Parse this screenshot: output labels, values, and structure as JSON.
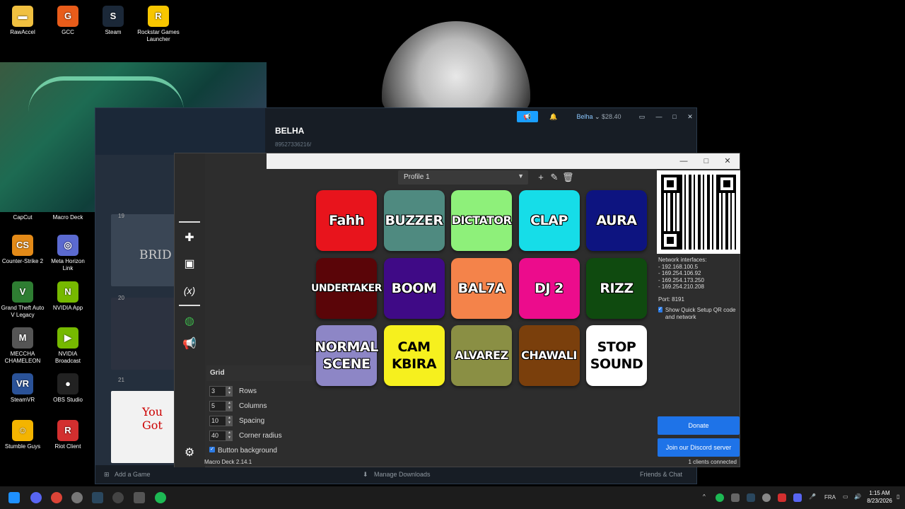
{
  "desktop_icons": [
    {
      "label": "RawAccel",
      "color": "#f0c040",
      "glyph": "▬"
    },
    {
      "label": "GCC",
      "color": "#e85c1a",
      "glyph": "G"
    },
    {
      "label": "Steam",
      "color": "#1b2838",
      "glyph": "S"
    },
    {
      "label": "Rockstar Games Launcher",
      "color": "#f7c600",
      "glyph": "R"
    },
    {
      "label": "CapCut",
      "color": "#222",
      "glyph": "✂"
    },
    {
      "label": "Macro Deck",
      "color": "#333",
      "glyph": "▦"
    },
    {
      "label": "Counter-Strike 2",
      "color": "#e38a18",
      "glyph": "CS"
    },
    {
      "label": "Meta Horizon Link",
      "color": "#5b6ad0",
      "glyph": "◎"
    },
    {
      "label": "Grand Theft Auto V Legacy",
      "color": "#2e7d32",
      "glyph": "V"
    },
    {
      "label": "NVIDIA App",
      "color": "#76b900",
      "glyph": "N"
    },
    {
      "label": "MECCHA CHAMELEON",
      "color": "#555",
      "glyph": "M"
    },
    {
      "label": "NVIDIA Broadcast",
      "color": "#76b900",
      "glyph": "▶"
    },
    {
      "label": "SteamVR",
      "color": "#2a5298",
      "glyph": "VR"
    },
    {
      "label": "OBS Studio",
      "color": "#222",
      "glyph": "●"
    },
    {
      "label": "Stumble Guys",
      "color": "#f4b400",
      "glyph": "☺"
    },
    {
      "label": "Riot Client",
      "color": "#d32f2f",
      "glyph": "R"
    }
  ],
  "steam": {
    "title": "BELHA",
    "subtitle": "89527336216/",
    "user": "Belha",
    "balance": "$28.40",
    "games": [
      "19",
      "20",
      "21"
    ],
    "tile_text": [
      "BRID",
      "You Got"
    ],
    "add_game": "Add a Game",
    "manage_downloads": "Manage Downloads",
    "friends_chat": "Friends & Chat"
  },
  "macro_deck": {
    "profile": "Profile 1",
    "version": "Macro Deck 2.14.1",
    "buttons": [
      {
        "label": "Fahh",
        "bg": "#e8141c",
        "color": "#ffffff"
      },
      {
        "label": "BUZZER",
        "bg": "#4f8a80",
        "color": "#ffffff"
      },
      {
        "label": "DICTATOR",
        "bg": "#8ef07a",
        "color": "#ffffff"
      },
      {
        "label": "CLAP",
        "bg": "#16dde8",
        "color": "#ffffff"
      },
      {
        "label": "AURA",
        "bg": "#0d1480",
        "color": "#ffffff"
      },
      {
        "label": "UNDERTAKER",
        "bg": "#5a0508",
        "color": "#ffffff"
      },
      {
        "label": "BOOM",
        "bg": "#3f0a86",
        "color": "#ffffff"
      },
      {
        "label": "BAL7A",
        "bg": "#f4834a",
        "color": "#ffffff"
      },
      {
        "label": "DJ 2",
        "bg": "#ec0c8c",
        "color": "#ffffff"
      },
      {
        "label": "RIZZ",
        "bg": "#0f4a0f",
        "color": "#ffffff"
      },
      {
        "label": "NORMAL SCENE",
        "bg": "#8d86c6",
        "color": "#ffffff"
      },
      {
        "label": "CAM KBIRA",
        "bg": "#f6f01e",
        "color": "#000000"
      },
      {
        "label": "ALVAREZ",
        "bg": "#8a8f44",
        "color": "#ffffff"
      },
      {
        "label": "CHAWALI",
        "bg": "#7a3f0c",
        "color": "#ffffff"
      },
      {
        "label": "STOP SOUND",
        "bg": "#ffffff",
        "color": "#000000"
      }
    ],
    "network": {
      "title": "Network interfaces:",
      "ips": [
        "- 192.168.100.5",
        "- 169.254.106.92",
        "- 169.254.173.250",
        "- 169.254.210.208"
      ],
      "port": "Port: 8191",
      "show_qr": "Show Quick Setup QR code and network"
    },
    "donate": "Donate",
    "discord": "Join our Discord server",
    "clients": "1 clients connected",
    "grid": {
      "title": "Grid",
      "rows": {
        "value": "3",
        "label": "Rows"
      },
      "columns": {
        "value": "5",
        "label": "Columns"
      },
      "spacing": {
        "value": "10",
        "label": "Spacing"
      },
      "radius": {
        "value": "40",
        "label": "Corner radius"
      },
      "background": "Button background"
    }
  },
  "taskbar": {
    "lang": "FRA",
    "time": "1:15 AM",
    "date": "8/23/2026"
  }
}
